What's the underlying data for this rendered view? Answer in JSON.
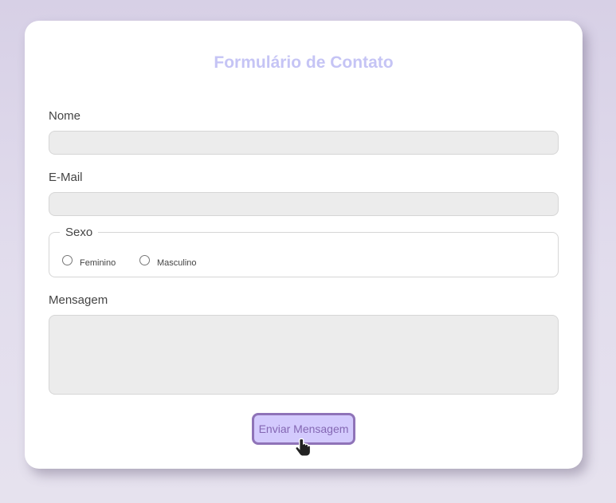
{
  "form": {
    "title": "Formulário de Contato",
    "name_label": "Nome",
    "name_value": "",
    "email_label": "E-Mail",
    "email_value": "",
    "sex_legend": "Sexo",
    "sex_options": [
      "Feminino",
      "Masculino"
    ],
    "message_label": "Mensagem",
    "message_value": "",
    "submit_label": "Enviar Mensagem"
  },
  "colors": {
    "title": "#c5c4f5",
    "button_bg": "#d3cafd",
    "button_border": "#8f73b8",
    "button_text": "#8467b3",
    "field_bg": "#ececec"
  },
  "icons": {
    "cursor": "hand-pointer-icon"
  }
}
